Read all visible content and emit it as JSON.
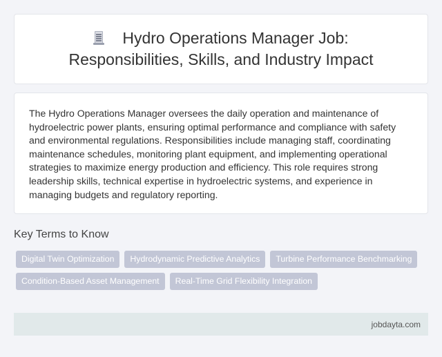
{
  "header": {
    "icon": "document-icon",
    "title": "Hydro Operations Manager Job: Responsibilities, Skills, and Industry Impact"
  },
  "description": "The Hydro Operations Manager oversees the daily operation and maintenance of hydroelectric power plants, ensuring optimal performance and compliance with safety and environmental regulations. Responsibilities include managing staff, coordinating maintenance schedules, monitoring plant equipment, and implementing operational strategies to maximize energy production and efficiency. This role requires strong leadership skills, technical expertise in hydroelectric systems, and experience in managing budgets and regulatory reporting.",
  "key_terms": {
    "heading": "Key Terms to Know",
    "tags": [
      "Digital Twin Optimization",
      "Hydrodynamic Predictive Analytics",
      "Turbine Performance Benchmarking",
      "Condition-Based Asset Management",
      "Real-Time Grid Flexibility Integration"
    ]
  },
  "footer": {
    "site": "jobdayta.com"
  },
  "colors": {
    "background": "#f3f4f8",
    "card": "#ffffff",
    "tag": "#c2c6d6",
    "footer": "#e1e9ea"
  }
}
